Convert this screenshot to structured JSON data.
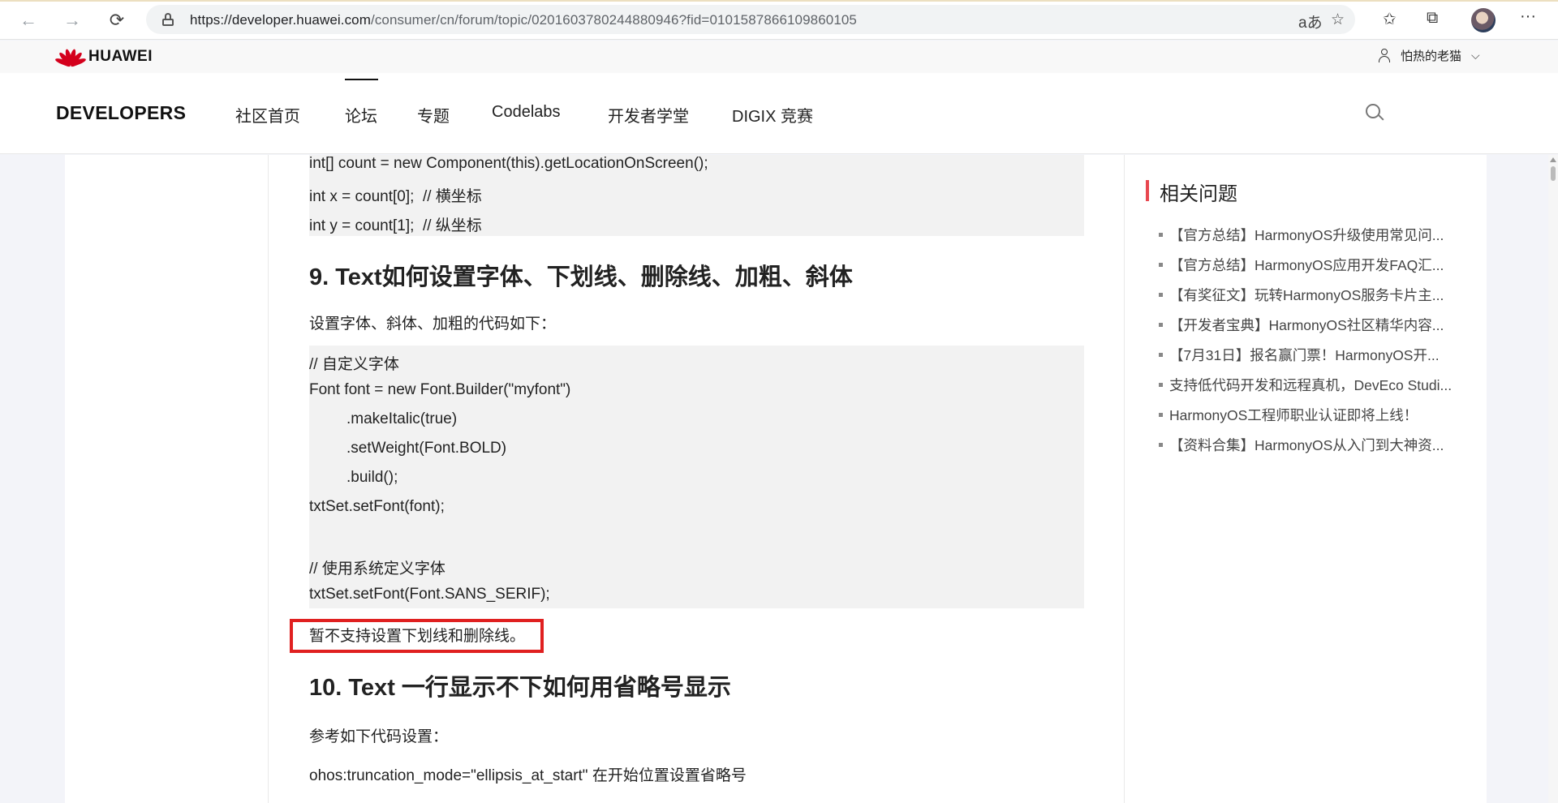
{
  "browser": {
    "back_icon": "arrow-left-icon",
    "forward_icon": "arrow-right-icon",
    "refresh_icon": "refresh-icon",
    "url_host": "https://developer.huawei.com",
    "url_path": "/consumer/cn/forum/topic/0201603780244880946?fid=0101587866109860105",
    "read_aloud": "aあ"
  },
  "site": {
    "brand": "HUAWEI",
    "user_name": "怕热的老猫",
    "developers": "DEVELOPERS",
    "nav": [
      "社区首页",
      "论坛",
      "专题",
      "Codelabs",
      "开发者学堂",
      "DIGIX 竞赛"
    ],
    "active_nav": "论坛"
  },
  "article": {
    "code_top": [
      "int[] count = new Component(this).getLocationOnScreen();",
      "int x = count[0];  // 横坐标",
      "int y = count[1];  // 纵坐标"
    ],
    "h2_9": "9. Text如何设置字体、下划线、删除线、加粗、斜体",
    "intro_9": "设置字体、斜体、加粗的代码如下：",
    "code_font": [
      "// 自定义字体",
      "Font font = new Font.Builder(\"myfont\")",
      ".makeItalic(true)",
      ".setWeight(Font.BOLD)",
      ".build();",
      "txtSet.setFont(font);",
      "",
      "// 使用系统定义字体",
      "txtSet.setFont(Font.SANS_SERIF);"
    ],
    "note": "暂不支持设置下划线和删除线。",
    "h2_10": "10. Text 一行显示不下如何用省略号显示",
    "intro_10": "参考如下代码设置：",
    "truncation": "ohos:truncation_mode=\"ellipsis_at_start\" 在开始位置设置省略号"
  },
  "sidebar": {
    "title": "相关问题",
    "items": [
      "【官方总结】HarmonyOS升级使用常见问...",
      "【官方总结】HarmonyOS应用开发FAQ汇...",
      "【有奖征文】玩转HarmonyOS服务卡片主...",
      "【开发者宝典】HarmonyOS社区精华内容...",
      "【7月31日】报名赢门票！HarmonyOS开...",
      "支持低代码开发和远程真机，DevEco Studi...",
      "HarmonyOS工程师职业认证即将上线！",
      "【资料合集】HarmonyOS从入门到大神资..."
    ]
  },
  "colors": {
    "accent_red": "#e8474f",
    "highlight": "#e02020",
    "brand_red": "#d4001c"
  }
}
